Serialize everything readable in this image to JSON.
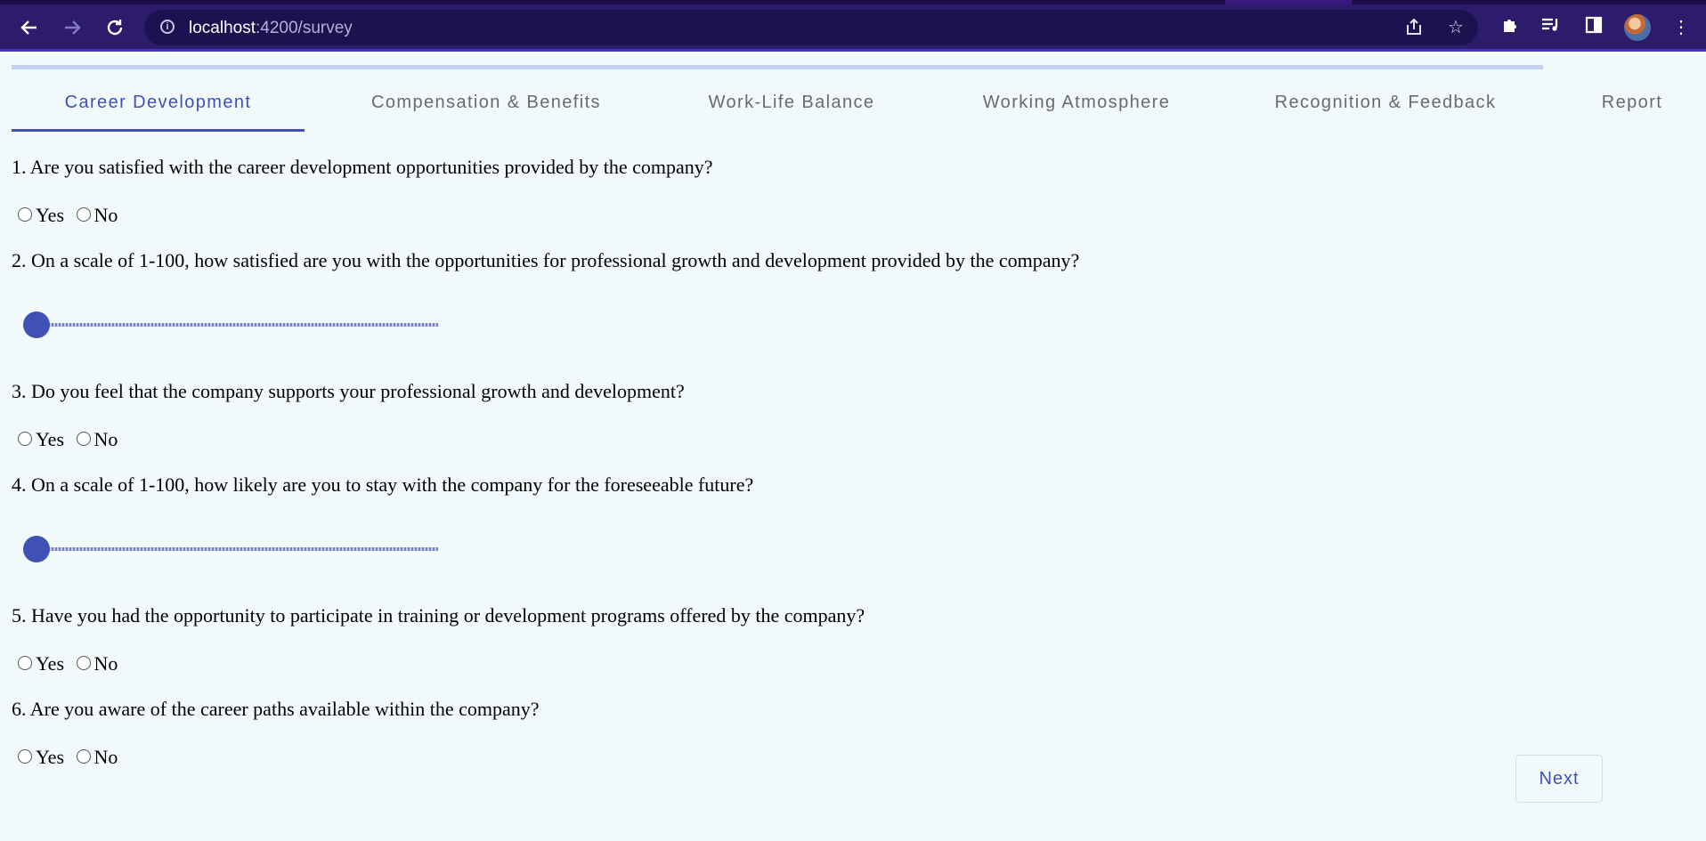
{
  "browser": {
    "url_host": "localhost",
    "url_path": ":4200/survey",
    "back_icon": "arrow-left",
    "forward_icon": "arrow-right",
    "reload_icon": "reload"
  },
  "survey": {
    "progress_percent": 0,
    "tabs": [
      {
        "label": "Career Development",
        "active": true
      },
      {
        "label": "Compensation & Benefits",
        "active": false
      },
      {
        "label": "Work-Life Balance",
        "active": false
      },
      {
        "label": "Working Atmosphere",
        "active": false
      },
      {
        "label": "Recognition & Feedback",
        "active": false
      },
      {
        "label": "Report",
        "active": false
      }
    ],
    "questions": [
      {
        "text": "1. Are you satisfied with the career development opportunities provided by the company?",
        "type": "yesno",
        "yes": "Yes",
        "no": "No"
      },
      {
        "text": "2. On a scale of 1-100, how satisfied are you with the opportunities for professional growth and development provided by the company?",
        "type": "slider",
        "value": 1
      },
      {
        "text": "3. Do you feel that the company supports your professional growth and development?",
        "type": "yesno",
        "yes": "Yes",
        "no": "No"
      },
      {
        "text": "4. On a scale of 1-100, how likely are you to stay with the company for the foreseeable future?",
        "type": "slider",
        "value": 1
      },
      {
        "text": "5. Have you had the opportunity to participate in training or development programs offered by the company?",
        "type": "yesno",
        "yes": "Yes",
        "no": "No"
      },
      {
        "text": "6. Are you aware of the career paths available within the company?",
        "type": "yesno",
        "yes": "Yes",
        "no": "No"
      }
    ],
    "next_label": "Next"
  },
  "colors": {
    "primary": "#3f51b5",
    "page_background": "#f1f9fb",
    "browser_frame": "#2c1c6b"
  }
}
